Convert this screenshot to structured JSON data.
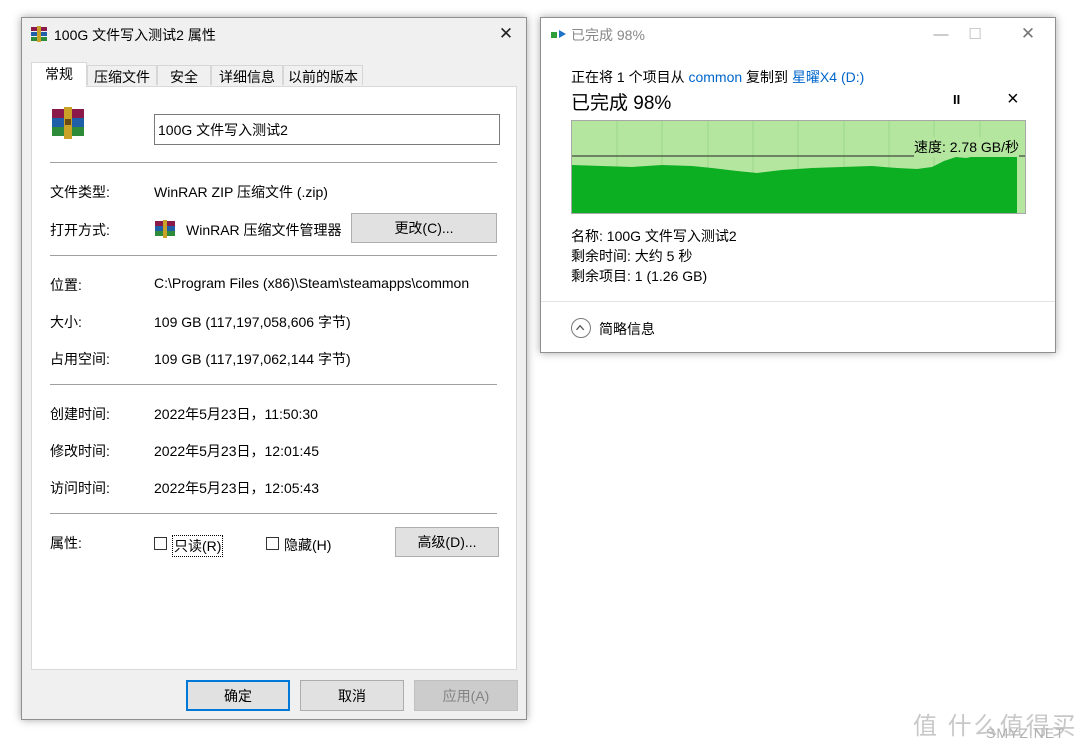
{
  "props": {
    "title": "100G 文件写入测试2 属性",
    "tabs": [
      "常规",
      "压缩文件",
      "安全",
      "详细信息",
      "以前的版本"
    ],
    "filename": "100G 文件写入测试2",
    "fields": {
      "type_label": "文件类型:",
      "type_value": "WinRAR ZIP 压缩文件 (.zip)",
      "open_label": "打开方式:",
      "open_value": "WinRAR 压缩文件管理器",
      "change_button": "更改(C)...",
      "location_label": "位置:",
      "location_value": "C:\\Program Files (x86)\\Steam\\steamapps\\common",
      "size_label": "大小:",
      "size_value": "109 GB (117,197,058,606 字节)",
      "ondisk_label": "占用空间:",
      "ondisk_value": "109 GB (117,197,062,144 字节)",
      "created_label": "创建时间:",
      "created_value": "2022年5月23日，11:50:30",
      "modified_label": "修改时间:",
      "modified_value": "2022年5月23日，12:01:45",
      "accessed_label": "访问时间:",
      "accessed_value": "2022年5月23日，12:05:43",
      "attr_label": "属性:",
      "readonly_label": "只读(R)",
      "hidden_label": "隐藏(H)",
      "advanced_button": "高级(D)..."
    },
    "buttons": {
      "ok": "确定",
      "cancel": "取消",
      "apply": "应用(A)"
    }
  },
  "copy": {
    "title": "已完成 98%",
    "line_pre": "正在将 1 个项目从",
    "source": "common",
    "line_mid": "复制到",
    "dest": "星曜X4 (D:)",
    "status": "已完成 98%",
    "pause_glyph": "II",
    "close_glyph": "×",
    "speed": "速度: 2.78 GB/秒",
    "progress_fraction": 0.98,
    "name_line": "名称: 100G 文件写入测试2",
    "time_line": "剩余时间: 大约 5 秒",
    "items_line": "剩余项目: 1 (1.26 GB)",
    "details_toggle": "简略信息"
  },
  "watermark": {
    "brand": "值 什么值得买",
    "site": "SMYZ.NET"
  },
  "colors": {
    "graph_fill": "#0cae22",
    "graph_bg": "#b4e6a0",
    "link": "#0066cc",
    "accent": "#0078d7"
  }
}
